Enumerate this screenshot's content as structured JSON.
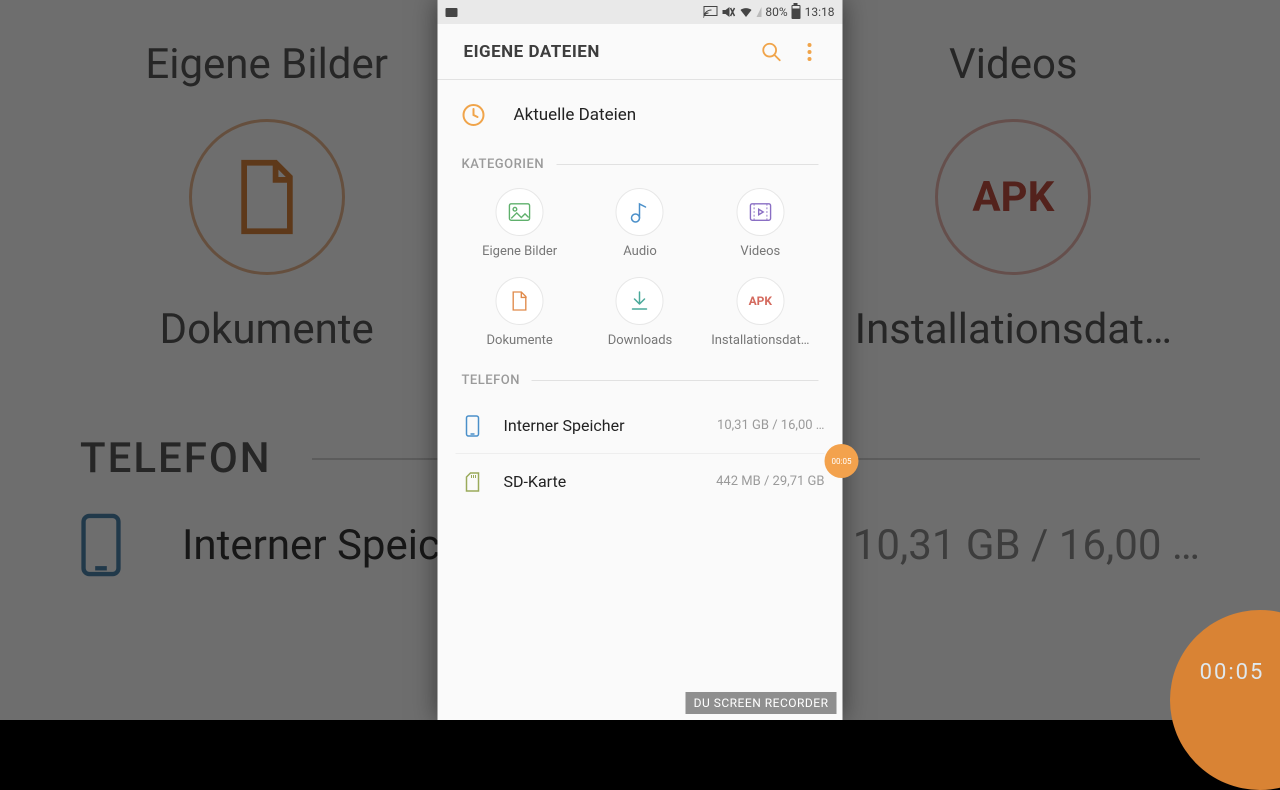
{
  "status_bar": {
    "battery_pct": "80%",
    "time": "13:18"
  },
  "app_bar": {
    "title": "EIGENE DATEIEN"
  },
  "recent": {
    "label": "Aktuelle Dateien"
  },
  "categories": {
    "header": "KATEGORIEN",
    "items": [
      {
        "label": "Eigene Bilder"
      },
      {
        "label": "Audio"
      },
      {
        "label": "Videos"
      },
      {
        "label": "Dokumente"
      },
      {
        "label": "Downloads"
      },
      {
        "label": "Installationsdat…"
      }
    ]
  },
  "phone_section": {
    "header": "TELEFON",
    "items": [
      {
        "name": "Interner Speicher",
        "size": "10,31 GB / 16,00 …"
      },
      {
        "name": "SD-Karte",
        "size": "442 MB / 29,71 GB"
      }
    ]
  },
  "recorder": {
    "watermark": "DU SCREEN RECORDER",
    "timer_small": "00:05",
    "timer_big": "00:05"
  },
  "apk_badge": "APK",
  "bg": {
    "label_left_top": "Eigene Bilder",
    "label_right_top": "Videos",
    "label_left_mid": "Dokumente",
    "label_right_mid": "Installationsdat…",
    "head": "TELEFON",
    "stor_name": "Interner Speicher",
    "stor_size": "10,31 GB / 16,00 …"
  }
}
